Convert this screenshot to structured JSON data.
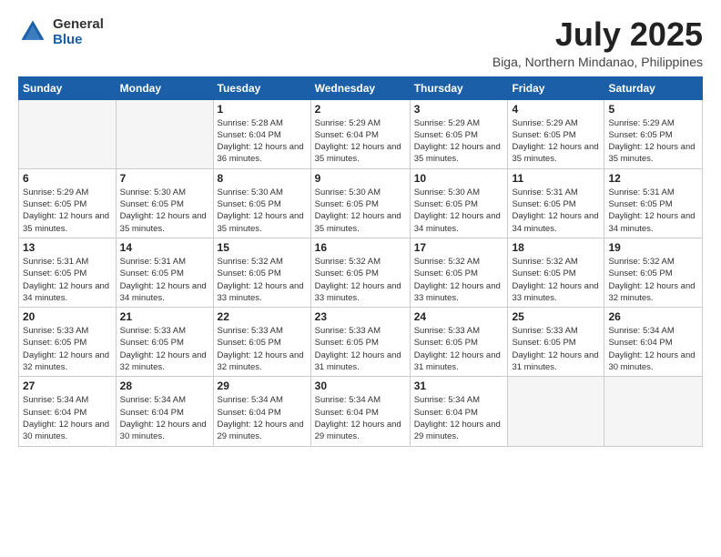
{
  "logo": {
    "general": "General",
    "blue": "Blue"
  },
  "title": "July 2025",
  "location": "Biga, Northern Mindanao, Philippines",
  "headers": [
    "Sunday",
    "Monday",
    "Tuesday",
    "Wednesday",
    "Thursday",
    "Friday",
    "Saturday"
  ],
  "weeks": [
    [
      {
        "day": "",
        "detail": ""
      },
      {
        "day": "",
        "detail": ""
      },
      {
        "day": "1",
        "detail": "Sunrise: 5:28 AM\nSunset: 6:04 PM\nDaylight: 12 hours and 36 minutes."
      },
      {
        "day": "2",
        "detail": "Sunrise: 5:29 AM\nSunset: 6:04 PM\nDaylight: 12 hours and 35 minutes."
      },
      {
        "day": "3",
        "detail": "Sunrise: 5:29 AM\nSunset: 6:05 PM\nDaylight: 12 hours and 35 minutes."
      },
      {
        "day": "4",
        "detail": "Sunrise: 5:29 AM\nSunset: 6:05 PM\nDaylight: 12 hours and 35 minutes."
      },
      {
        "day": "5",
        "detail": "Sunrise: 5:29 AM\nSunset: 6:05 PM\nDaylight: 12 hours and 35 minutes."
      }
    ],
    [
      {
        "day": "6",
        "detail": "Sunrise: 5:29 AM\nSunset: 6:05 PM\nDaylight: 12 hours and 35 minutes."
      },
      {
        "day": "7",
        "detail": "Sunrise: 5:30 AM\nSunset: 6:05 PM\nDaylight: 12 hours and 35 minutes."
      },
      {
        "day": "8",
        "detail": "Sunrise: 5:30 AM\nSunset: 6:05 PM\nDaylight: 12 hours and 35 minutes."
      },
      {
        "day": "9",
        "detail": "Sunrise: 5:30 AM\nSunset: 6:05 PM\nDaylight: 12 hours and 35 minutes."
      },
      {
        "day": "10",
        "detail": "Sunrise: 5:30 AM\nSunset: 6:05 PM\nDaylight: 12 hours and 34 minutes."
      },
      {
        "day": "11",
        "detail": "Sunrise: 5:31 AM\nSunset: 6:05 PM\nDaylight: 12 hours and 34 minutes."
      },
      {
        "day": "12",
        "detail": "Sunrise: 5:31 AM\nSunset: 6:05 PM\nDaylight: 12 hours and 34 minutes."
      }
    ],
    [
      {
        "day": "13",
        "detail": "Sunrise: 5:31 AM\nSunset: 6:05 PM\nDaylight: 12 hours and 34 minutes."
      },
      {
        "day": "14",
        "detail": "Sunrise: 5:31 AM\nSunset: 6:05 PM\nDaylight: 12 hours and 34 minutes."
      },
      {
        "day": "15",
        "detail": "Sunrise: 5:32 AM\nSunset: 6:05 PM\nDaylight: 12 hours and 33 minutes."
      },
      {
        "day": "16",
        "detail": "Sunrise: 5:32 AM\nSunset: 6:05 PM\nDaylight: 12 hours and 33 minutes."
      },
      {
        "day": "17",
        "detail": "Sunrise: 5:32 AM\nSunset: 6:05 PM\nDaylight: 12 hours and 33 minutes."
      },
      {
        "day": "18",
        "detail": "Sunrise: 5:32 AM\nSunset: 6:05 PM\nDaylight: 12 hours and 33 minutes."
      },
      {
        "day": "19",
        "detail": "Sunrise: 5:32 AM\nSunset: 6:05 PM\nDaylight: 12 hours and 32 minutes."
      }
    ],
    [
      {
        "day": "20",
        "detail": "Sunrise: 5:33 AM\nSunset: 6:05 PM\nDaylight: 12 hours and 32 minutes."
      },
      {
        "day": "21",
        "detail": "Sunrise: 5:33 AM\nSunset: 6:05 PM\nDaylight: 12 hours and 32 minutes."
      },
      {
        "day": "22",
        "detail": "Sunrise: 5:33 AM\nSunset: 6:05 PM\nDaylight: 12 hours and 32 minutes."
      },
      {
        "day": "23",
        "detail": "Sunrise: 5:33 AM\nSunset: 6:05 PM\nDaylight: 12 hours and 31 minutes."
      },
      {
        "day": "24",
        "detail": "Sunrise: 5:33 AM\nSunset: 6:05 PM\nDaylight: 12 hours and 31 minutes."
      },
      {
        "day": "25",
        "detail": "Sunrise: 5:33 AM\nSunset: 6:05 PM\nDaylight: 12 hours and 31 minutes."
      },
      {
        "day": "26",
        "detail": "Sunrise: 5:34 AM\nSunset: 6:04 PM\nDaylight: 12 hours and 30 minutes."
      }
    ],
    [
      {
        "day": "27",
        "detail": "Sunrise: 5:34 AM\nSunset: 6:04 PM\nDaylight: 12 hours and 30 minutes."
      },
      {
        "day": "28",
        "detail": "Sunrise: 5:34 AM\nSunset: 6:04 PM\nDaylight: 12 hours and 30 minutes."
      },
      {
        "day": "29",
        "detail": "Sunrise: 5:34 AM\nSunset: 6:04 PM\nDaylight: 12 hours and 29 minutes."
      },
      {
        "day": "30",
        "detail": "Sunrise: 5:34 AM\nSunset: 6:04 PM\nDaylight: 12 hours and 29 minutes."
      },
      {
        "day": "31",
        "detail": "Sunrise: 5:34 AM\nSunset: 6:04 PM\nDaylight: 12 hours and 29 minutes."
      },
      {
        "day": "",
        "detail": ""
      },
      {
        "day": "",
        "detail": ""
      }
    ]
  ]
}
